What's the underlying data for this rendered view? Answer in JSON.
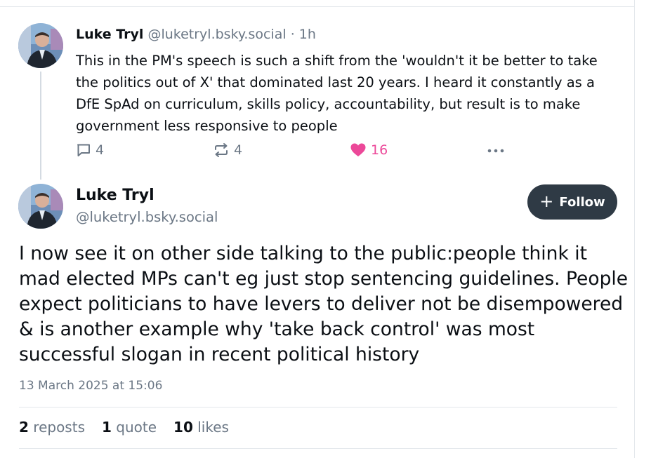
{
  "parent_post": {
    "author_name": "Luke Tryl",
    "handle": "@luketryl.bsky.social",
    "separator": "·",
    "time_ago": "1h",
    "text": "This in the PM's speech is such a shift from the 'wouldn't it be better to take the politics out of X' that dominated last 20 years. I heard it constantly as a DfE SpAd on curriculum, skills policy, accountability, but result is to make government less responsive to people",
    "reply_count": "4",
    "repost_count": "4",
    "like_count": "16",
    "icons": [
      "reply-icon",
      "repost-icon",
      "heart-icon",
      "more-icon"
    ]
  },
  "main_post": {
    "author_name": "Luke Tryl",
    "handle": "@luketryl.bsky.social",
    "follow_label": "Follow",
    "text": "I now see it on other side talking to the public:people think it mad elected MPs can't eg just stop sentencing guidelines. People expect politicians to have levers to deliver not be disempowered & is another example why 'take back control' was most successful slogan in recent political history",
    "timestamp": "13 March 2025 at 15:06",
    "stats": {
      "reposts_count": "2",
      "reposts_label": "reposts",
      "quotes_count": "1",
      "quotes_label": "quote",
      "likes_count": "10",
      "likes_label": "likes"
    }
  },
  "colors": {
    "like_pink": "#ec4899",
    "muted_text": "#6b7785",
    "follow_button_bg": "#2f3a45"
  }
}
